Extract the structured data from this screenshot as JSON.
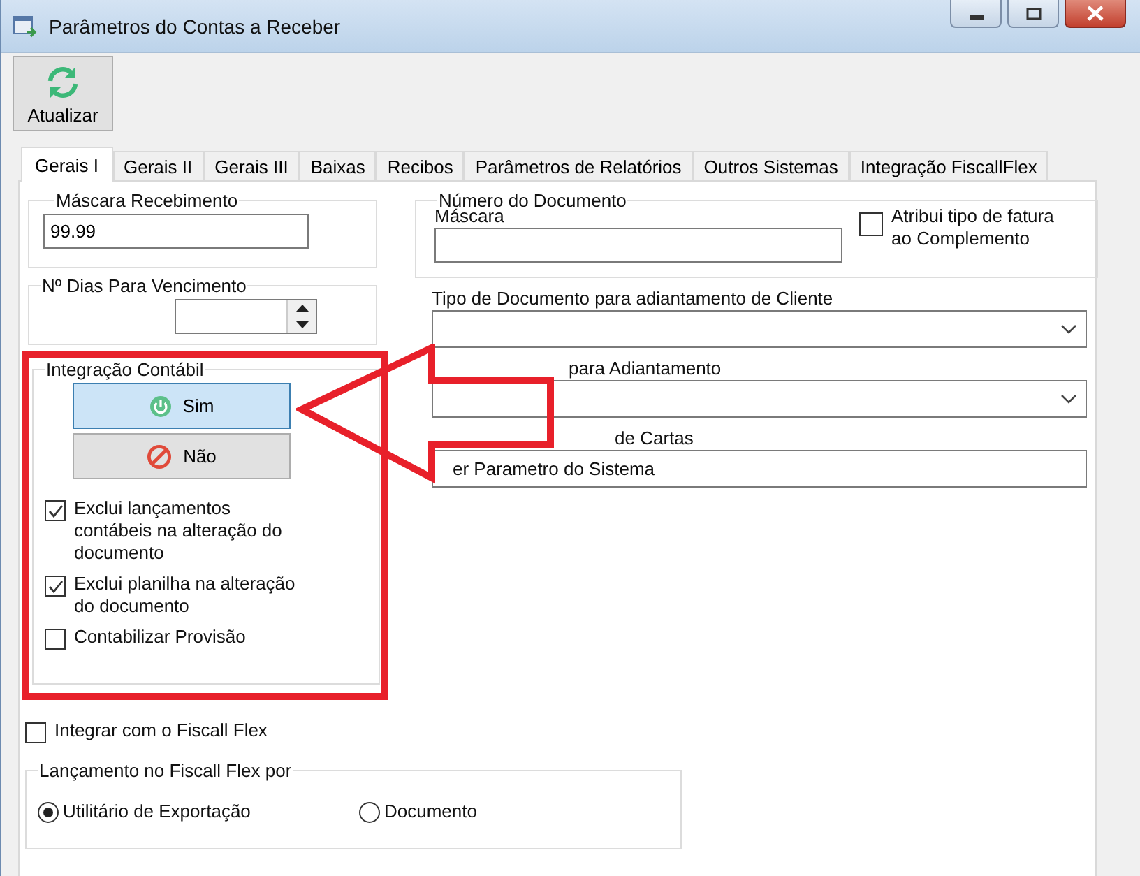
{
  "window": {
    "title": "Parâmetros do Contas a Receber"
  },
  "toolbar": [
    {
      "label": "Atualizar"
    }
  ],
  "tabs": [
    {
      "label": "Gerais I",
      "selected": true
    },
    {
      "label": "Gerais II",
      "selected": false
    },
    {
      "label": "Gerais III",
      "selected": false
    },
    {
      "label": "Baixas",
      "selected": false
    },
    {
      "label": "Recibos",
      "selected": false
    },
    {
      "label": "Parâmetros de Relatórios",
      "selected": false
    },
    {
      "label": "Outros Sistemas",
      "selected": false
    },
    {
      "label": "Integração FiscallFlex",
      "selected": false
    }
  ],
  "mascara_recebimento": {
    "title": "Máscara Recebimento",
    "value": "99.99"
  },
  "dias_vencimento": {
    "title": "Nº Dias Para Vencimento"
  },
  "integracao_contabil": {
    "title": "Integração Contábil",
    "buttons": [
      {
        "label": "Sim",
        "kind": "yes",
        "selected": true
      },
      {
        "label": "Não",
        "kind": "no",
        "selected": false
      }
    ],
    "options": [
      {
        "label": "Exclui lançamentos contábeis na alteração do documento",
        "checked": true
      },
      {
        "label": "Exclui planilha na alteração do documento",
        "checked": true
      },
      {
        "label": "Contabilizar Provisão",
        "checked": false
      }
    ]
  },
  "integrar_fiscall": {
    "label": "Integrar com o Fiscall Flex",
    "checked": false
  },
  "lancamento": {
    "title": "Lançamento no Fiscall Flex por",
    "options": [
      {
        "label": "Utilitário de Exportação",
        "selected": true
      },
      {
        "label": "Documento",
        "selected": false
      }
    ]
  },
  "numero_documento": {
    "title": "Número do Documento",
    "mascara_label": "Máscara",
    "checkbox": {
      "label": "Atribui tipo de fatura ao Complemento",
      "checked": false
    }
  },
  "fields": [
    {
      "label": "Tipo de Documento para adiantamento de Cliente",
      "kind": "select"
    },
    {
      "label": "para Adiantamento",
      "kind": "select"
    },
    {
      "label": "de Cartas",
      "kind": "text",
      "value": "er Parametro do Sistema"
    }
  ]
}
